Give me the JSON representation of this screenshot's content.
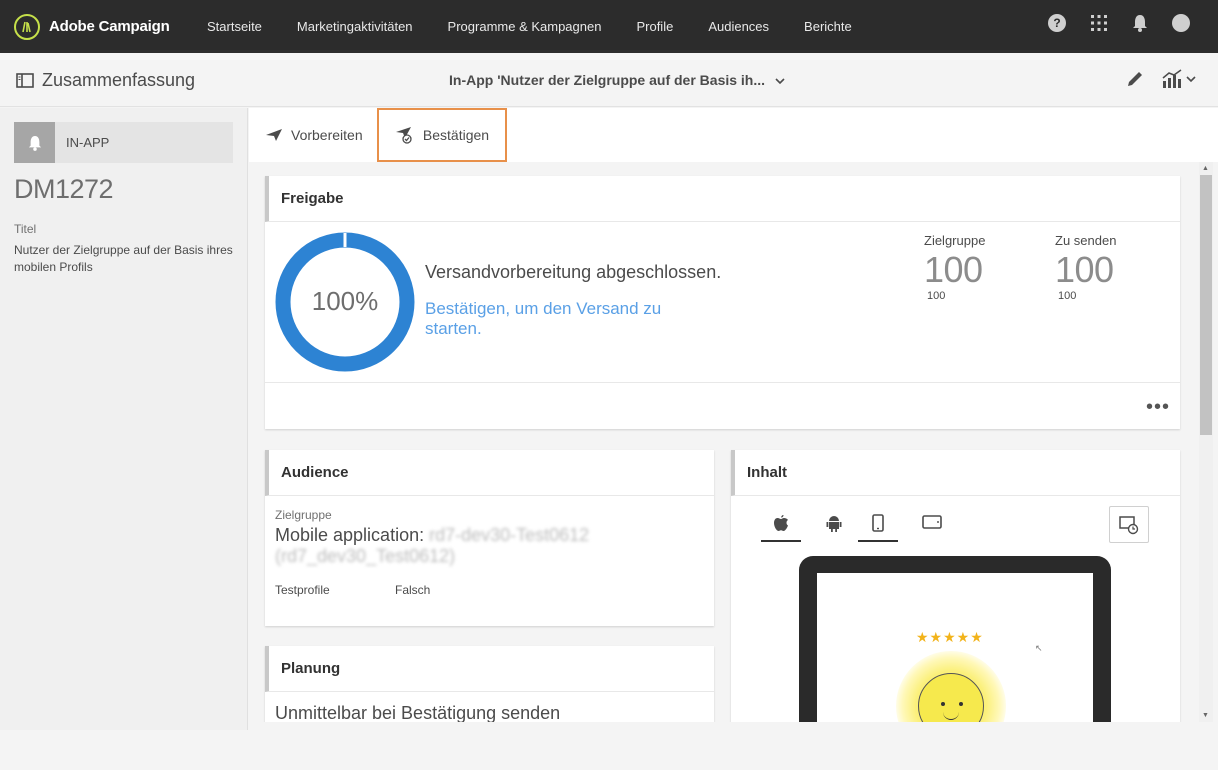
{
  "app": {
    "name": "Adobe Campaign"
  },
  "nav": {
    "items": [
      "Startseite",
      "Marketingaktivitäten",
      "Programme & Kampagnen",
      "Profile",
      "Audiences",
      "Berichte"
    ]
  },
  "topIcons": {
    "help": "?",
    "icons": [
      "help-icon",
      "apps-grid-icon",
      "bell-icon",
      "user-avatar-icon"
    ]
  },
  "subheader": {
    "summary_label": "Zusammenfassung",
    "delivery_title": "In-App 'Nutzer der Zielgruppe auf der Basis ih...",
    "chevron": "⌄"
  },
  "left": {
    "type_label": "IN-APP",
    "code": "DM1272",
    "title_label": "Titel",
    "title_value": "Nutzer der Zielgruppe auf der Basis ihres mobilen Profils"
  },
  "actions": {
    "prepare": "Vorbereiten",
    "confirm": "Bestätigen"
  },
  "freigabe": {
    "title": "Freigabe",
    "progress_label": "100%",
    "progress": 1.0,
    "status": "Versandvorbereitung abgeschlossen.",
    "link": "Bestätigen, um den Versand zu starten.",
    "stats": [
      {
        "label": "Zielgruppe",
        "value": "100",
        "sub": "100"
      },
      {
        "label": "Zu senden",
        "value": "100",
        "sub": "100"
      }
    ],
    "more": "•••"
  },
  "audience": {
    "title": "Audience",
    "target_label": "Zielgruppe",
    "target_prefix": "Mobile application: ",
    "target_blurred": "rd7-dev30-Test0612 (rd7_dev30_Test0612)",
    "testprofile_label": "Testprofile",
    "testprofile_value": "Falsch"
  },
  "planung": {
    "title": "Planung",
    "value": "Unmittelbar bei Bestätigung senden"
  },
  "inhalt": {
    "title": "Inhalt",
    "tabs": [
      "apple-icon",
      "android-icon",
      "phone-icon",
      "tablet-icon"
    ],
    "active_tab": 2,
    "stars": "★★★★★"
  },
  "colors": {
    "accent": "#2d83d3",
    "highlight": "#e8904a",
    "link": "#5aa0e6"
  }
}
